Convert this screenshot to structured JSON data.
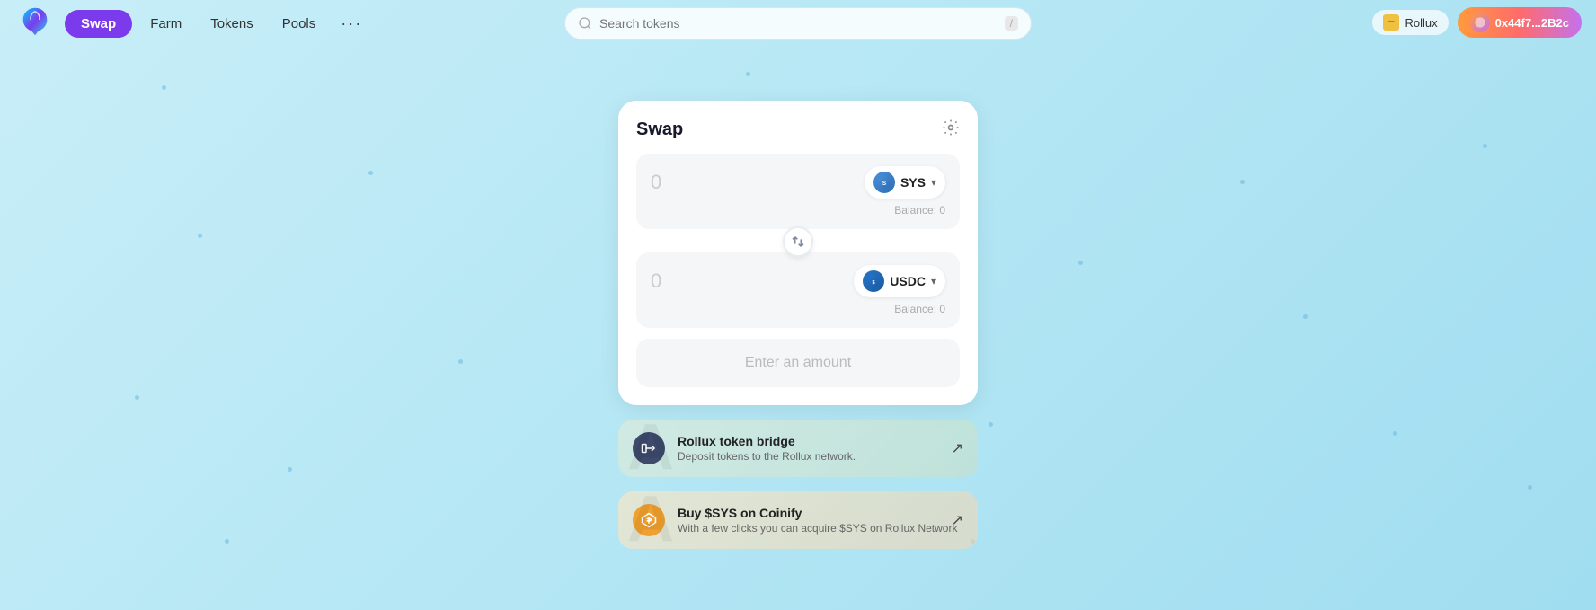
{
  "app": {
    "logo_alt": "Rollux Logo"
  },
  "nav": {
    "swap_label": "Swap",
    "farm_label": "Farm",
    "tokens_label": "Tokens",
    "pools_label": "Pools",
    "more_label": "···"
  },
  "search": {
    "placeholder": "Search tokens",
    "slash_hint": "/"
  },
  "wallet": {
    "network_label": "Rollux",
    "address_label": "0x44f7...2B2c"
  },
  "swap_card": {
    "title": "Swap",
    "from_amount": "0",
    "from_token": "SYS",
    "from_balance": "Balance: 0",
    "to_amount": "0",
    "to_token": "USDC",
    "to_balance": "Balance: 0",
    "enter_amount_label": "Enter an amount"
  },
  "info_cards": [
    {
      "title": "Rollux token bridge",
      "description": "Deposit tokens to the Rollux network.",
      "icon_type": "bridge",
      "watermark": "A"
    },
    {
      "title": "Buy $SYS on Coinify",
      "description": "With a few clicks you can acquire $SYS on Rollux Network",
      "icon_type": "coinify",
      "watermark": "A"
    }
  ]
}
